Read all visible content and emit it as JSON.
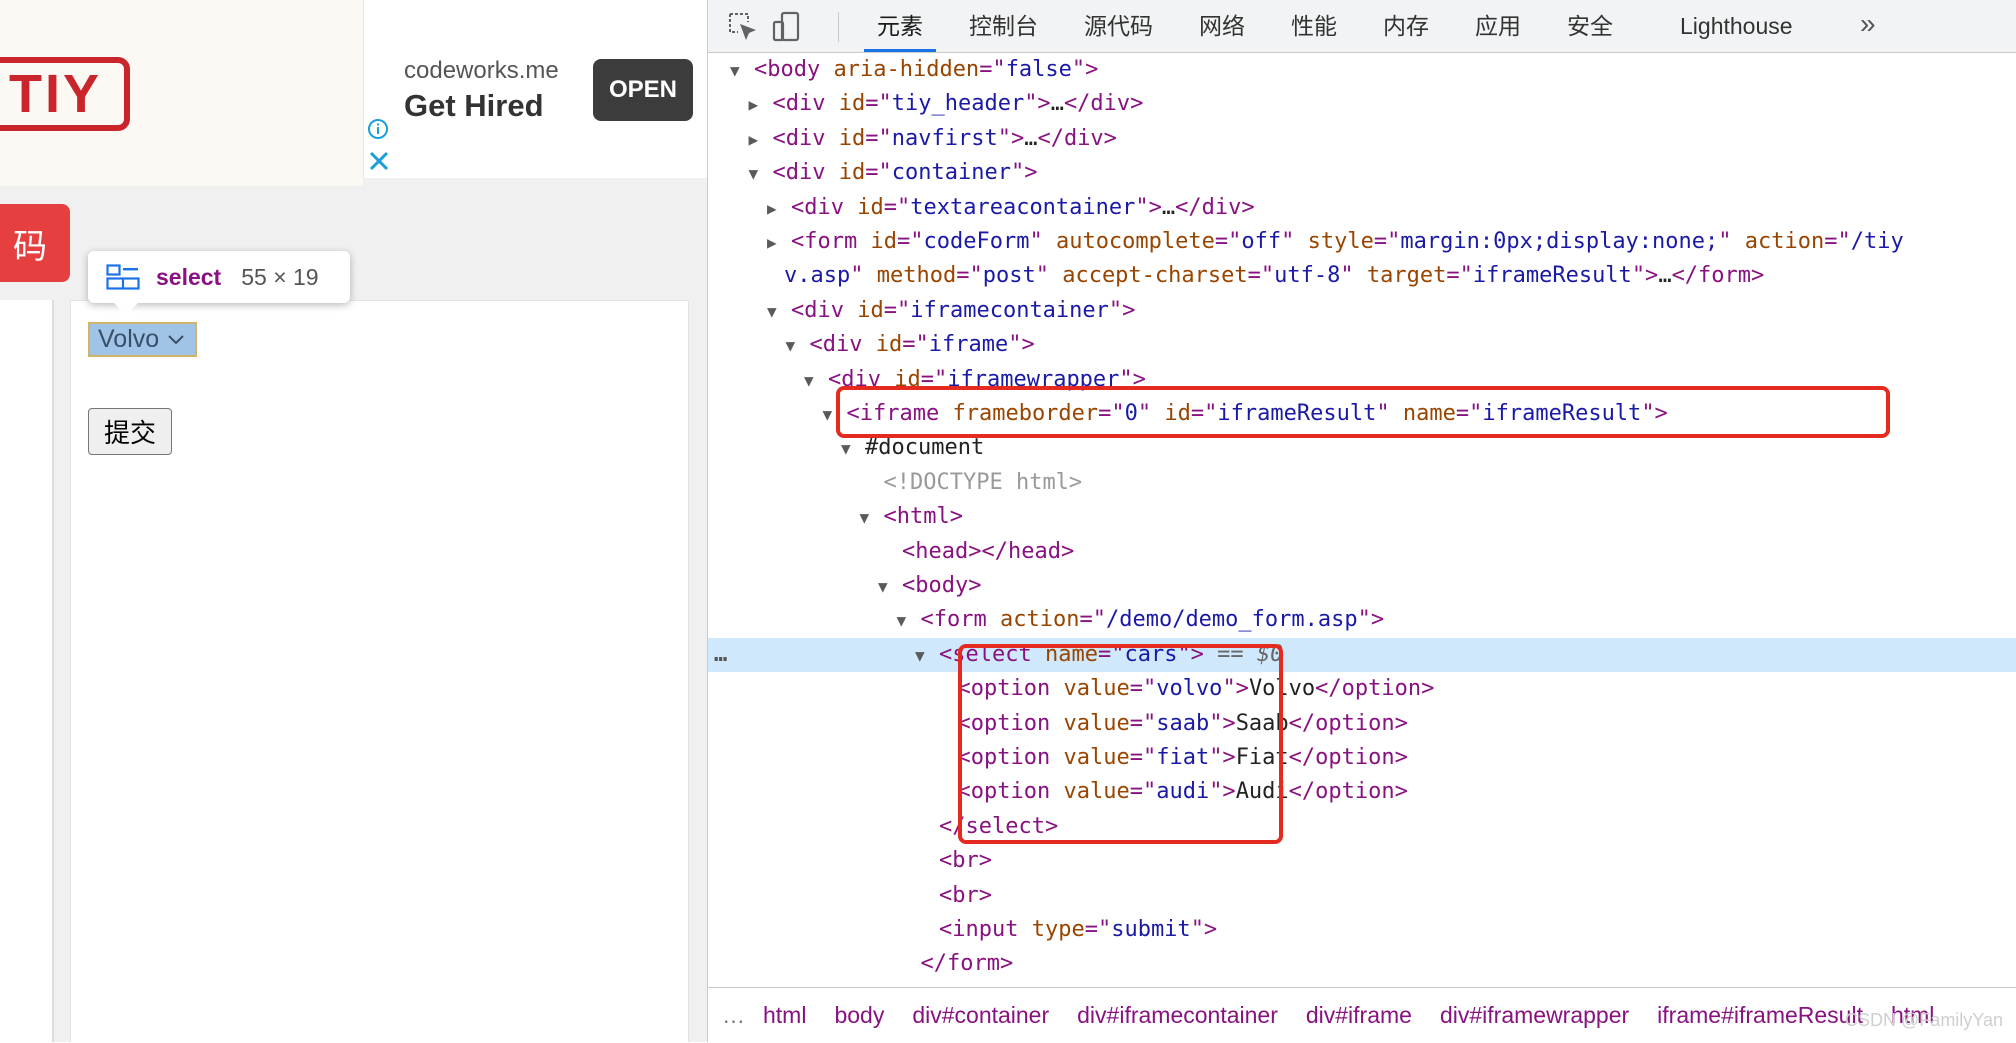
{
  "page": {
    "logo_text": "TIY",
    "ad": {
      "domain": "codeworks.me",
      "headline": "Get Hired",
      "open_label": "OPEN"
    },
    "run_button_label": "码",
    "tooltip": {
      "tag": "select",
      "size": "55 × 19"
    },
    "select_value": "Volvo",
    "submit_label": "提交"
  },
  "devtools": {
    "tabs": [
      {
        "label": "元素",
        "active": true
      },
      {
        "label": "控制台"
      },
      {
        "label": "源代码"
      },
      {
        "label": "网络"
      },
      {
        "label": "性能"
      },
      {
        "label": "内存"
      },
      {
        "label": "应用"
      },
      {
        "label": "安全"
      },
      {
        "label": "Lighthouse"
      }
    ],
    "more_tabs": "»",
    "dom": [
      {
        "indent": 0,
        "tw": "▼",
        "parts": [
          [
            "tag",
            "<body "
          ],
          [
            "an",
            "aria-hidden"
          ],
          [
            "tag",
            "=\""
          ],
          [
            "av",
            "false"
          ],
          [
            "tag",
            "\">"
          ]
        ]
      },
      {
        "indent": 1,
        "tw": "▶",
        "parts": [
          [
            "tag",
            "<div "
          ],
          [
            "an",
            "id"
          ],
          [
            "tag",
            "=\""
          ],
          [
            "av",
            "tiy_header"
          ],
          [
            "tag",
            "\">"
          ],
          [
            "tx",
            "…"
          ],
          [
            "tag",
            "</div>"
          ]
        ]
      },
      {
        "indent": 1,
        "tw": "▶",
        "parts": [
          [
            "tag",
            "<div "
          ],
          [
            "an",
            "id"
          ],
          [
            "tag",
            "=\""
          ],
          [
            "av",
            "navfirst"
          ],
          [
            "tag",
            "\">"
          ],
          [
            "tx",
            "…"
          ],
          [
            "tag",
            "</div>"
          ]
        ]
      },
      {
        "indent": 1,
        "tw": "▼",
        "parts": [
          [
            "tag",
            "<div "
          ],
          [
            "an",
            "id"
          ],
          [
            "tag",
            "=\""
          ],
          [
            "av",
            "container"
          ],
          [
            "tag",
            "\">"
          ]
        ]
      },
      {
        "indent": 2,
        "tw": "▶",
        "parts": [
          [
            "tag",
            "<div "
          ],
          [
            "an",
            "id"
          ],
          [
            "tag",
            "=\""
          ],
          [
            "av",
            "textareacontainer"
          ],
          [
            "tag",
            "\">"
          ],
          [
            "tx",
            "…"
          ],
          [
            "tag",
            "</div>"
          ]
        ]
      },
      {
        "indent": 2,
        "tw": "▶",
        "parts": [
          [
            "tag",
            "<form "
          ],
          [
            "an",
            "id"
          ],
          [
            "tag",
            "=\""
          ],
          [
            "av",
            "codeForm"
          ],
          [
            "tag",
            "\" "
          ],
          [
            "an",
            "autocomplete"
          ],
          [
            "tag",
            "=\""
          ],
          [
            "av",
            "off"
          ],
          [
            "tag",
            "\" "
          ],
          [
            "an",
            "style"
          ],
          [
            "tag",
            "=\""
          ],
          [
            "av",
            "margin:0px;display:none;"
          ],
          [
            "tag",
            "\" "
          ],
          [
            "an",
            "action"
          ],
          [
            "tag",
            "=\""
          ],
          [
            "av",
            "/tiy"
          ]
        ]
      },
      {
        "indent": 2,
        "tw": "",
        "wrap": true,
        "parts": [
          [
            "av",
            "v.asp"
          ],
          [
            "tag",
            "\" "
          ],
          [
            "an",
            "method"
          ],
          [
            "tag",
            "=\""
          ],
          [
            "av",
            "post"
          ],
          [
            "tag",
            "\" "
          ],
          [
            "an",
            "accept-charset"
          ],
          [
            "tag",
            "=\""
          ],
          [
            "av",
            "utf-8"
          ],
          [
            "tag",
            "\" "
          ],
          [
            "an",
            "target"
          ],
          [
            "tag",
            "=\""
          ],
          [
            "av",
            "iframeResult"
          ],
          [
            "tag",
            "\">"
          ],
          [
            "tx",
            "…"
          ],
          [
            "tag",
            "</form>"
          ]
        ]
      },
      {
        "indent": 2,
        "tw": "▼",
        "parts": [
          [
            "tag",
            "<div "
          ],
          [
            "an",
            "id"
          ],
          [
            "tag",
            "=\""
          ],
          [
            "av",
            "iframecontainer"
          ],
          [
            "tag",
            "\">"
          ]
        ]
      },
      {
        "indent": 3,
        "tw": "▼",
        "parts": [
          [
            "tag",
            "<div "
          ],
          [
            "an",
            "id"
          ],
          [
            "tag",
            "=\""
          ],
          [
            "av",
            "iframe"
          ],
          [
            "tag",
            "\">"
          ]
        ]
      },
      {
        "indent": 4,
        "tw": "▼",
        "parts": [
          [
            "tag",
            "<div "
          ],
          [
            "an",
            "id"
          ],
          [
            "tag",
            "=\""
          ],
          [
            "av",
            "iframewrapper"
          ],
          [
            "tag",
            "\">"
          ]
        ]
      },
      {
        "indent": 5,
        "tw": "▼",
        "parts": [
          [
            "tag",
            "<iframe "
          ],
          [
            "an",
            "frameborder"
          ],
          [
            "tag",
            "=\""
          ],
          [
            "av",
            "0"
          ],
          [
            "tag",
            "\" "
          ],
          [
            "an",
            "id"
          ],
          [
            "tag",
            "=\""
          ],
          [
            "av",
            "iframeResult"
          ],
          [
            "tag",
            "\" "
          ],
          [
            "an",
            "name"
          ],
          [
            "tag",
            "=\""
          ],
          [
            "av",
            "iframeResult"
          ],
          [
            "tag",
            "\">"
          ]
        ]
      },
      {
        "indent": 6,
        "tw": "▼",
        "parts": [
          [
            "tx",
            "#document"
          ]
        ]
      },
      {
        "indent": 7,
        "tw": "",
        "parts": [
          [
            "cm",
            "<!DOCTYPE html>"
          ]
        ]
      },
      {
        "indent": 7,
        "tw": "▼",
        "parts": [
          [
            "tag",
            "<html>"
          ]
        ]
      },
      {
        "indent": 8,
        "tw": "",
        "parts": [
          [
            "tag",
            "<head></head>"
          ]
        ]
      },
      {
        "indent": 8,
        "tw": "▼",
        "parts": [
          [
            "tag",
            "<body>"
          ]
        ]
      },
      {
        "indent": 9,
        "tw": "▼",
        "parts": [
          [
            "tag",
            "<form "
          ],
          [
            "an",
            "action"
          ],
          [
            "tag",
            "=\""
          ],
          [
            "av",
            "/demo/demo_form.asp"
          ],
          [
            "tag",
            "\">"
          ]
        ]
      },
      {
        "indent": 10,
        "tw": "▼",
        "selected": true,
        "parts": [
          [
            "tag",
            "<select "
          ],
          [
            "an",
            "name"
          ],
          [
            "tag",
            "=\""
          ],
          [
            "av",
            "cars"
          ],
          [
            "tag",
            "\">"
          ],
          [
            "eq0",
            " == $0"
          ]
        ]
      },
      {
        "indent": 11,
        "tw": "",
        "parts": [
          [
            "tag",
            "<option "
          ],
          [
            "an",
            "value"
          ],
          [
            "tag",
            "=\""
          ],
          [
            "av",
            "volvo"
          ],
          [
            "tag",
            "\">"
          ],
          [
            "tx",
            "Volvo"
          ],
          [
            "tag",
            "</option>"
          ]
        ]
      },
      {
        "indent": 11,
        "tw": "",
        "parts": [
          [
            "tag",
            "<option "
          ],
          [
            "an",
            "value"
          ],
          [
            "tag",
            "=\""
          ],
          [
            "av",
            "saab"
          ],
          [
            "tag",
            "\">"
          ],
          [
            "tx",
            "Saab"
          ],
          [
            "tag",
            "</option>"
          ]
        ]
      },
      {
        "indent": 11,
        "tw": "",
        "parts": [
          [
            "tag",
            "<option "
          ],
          [
            "an",
            "value"
          ],
          [
            "tag",
            "=\""
          ],
          [
            "av",
            "fiat"
          ],
          [
            "tag",
            "\">"
          ],
          [
            "tx",
            "Fiat"
          ],
          [
            "tag",
            "</option>"
          ]
        ]
      },
      {
        "indent": 11,
        "tw": "",
        "parts": [
          [
            "tag",
            "<option "
          ],
          [
            "an",
            "value"
          ],
          [
            "tag",
            "=\""
          ],
          [
            "av",
            "audi"
          ],
          [
            "tag",
            "\">"
          ],
          [
            "tx",
            "Audi"
          ],
          [
            "tag",
            "</option>"
          ]
        ]
      },
      {
        "indent": 10,
        "tw": "",
        "parts": [
          [
            "tag",
            "</select>"
          ]
        ]
      },
      {
        "indent": 10,
        "tw": "",
        "parts": [
          [
            "tag",
            "<br>"
          ]
        ]
      },
      {
        "indent": 10,
        "tw": "",
        "parts": [
          [
            "tag",
            "<br>"
          ]
        ]
      },
      {
        "indent": 10,
        "tw": "",
        "parts": [
          [
            "tag",
            "<input "
          ],
          [
            "an",
            "type"
          ],
          [
            "tag",
            "=\""
          ],
          [
            "av",
            "submit"
          ],
          [
            "tag",
            "\">"
          ]
        ]
      },
      {
        "indent": 9,
        "tw": "",
        "parts": [
          [
            "tag",
            "</form>"
          ]
        ]
      }
    ],
    "selected_dots": "…",
    "breadcrumbs": [
      "html",
      "body",
      "div#container",
      "div#iframecontainer",
      "div#iframe",
      "div#iframewrapper",
      "iframe#iframeResult",
      "html"
    ],
    "breadcrumb_dots": "…",
    "watermark": "CSDN @FamilyYan"
  },
  "colors": {
    "tag": "#881280",
    "attr_name": "#994500",
    "attr_value": "#1a1aa6",
    "highlight_box": "#e52b20",
    "selected_row": "#cfe8fc",
    "active_tab_underline": "#1a73e8"
  }
}
